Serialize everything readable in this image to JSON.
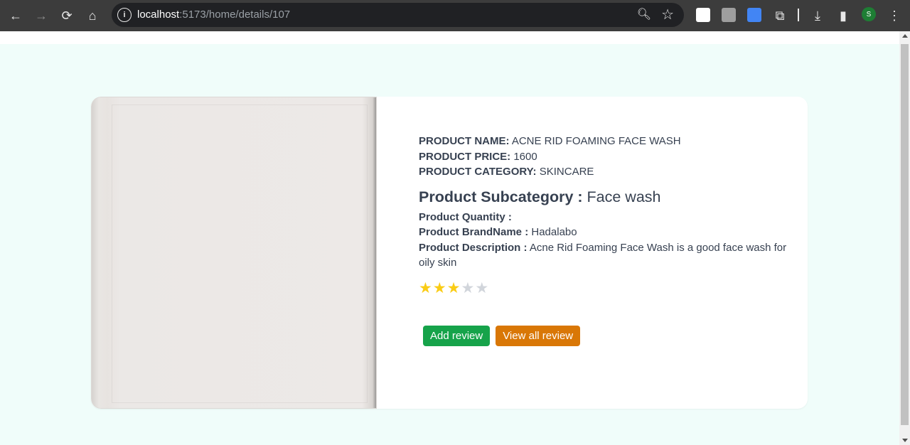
{
  "browser": {
    "url_host": "localhost",
    "url_path": ":5173/home/details/107",
    "profile_initial": "S",
    "icons": [
      "back-arrow-icon",
      "forward-arrow-icon",
      "reload-icon",
      "home-icon",
      "site-info-icon",
      "zoom-icon",
      "bookmark-star-icon",
      "extension-icon",
      "download-icon",
      "side-panel-icon",
      "menu-icon"
    ]
  },
  "product": {
    "name_label": "PRODUCT NAME:",
    "name_value": " ACNE RID FOAMING FACE WASH",
    "price_label": "PRODUCT PRICE:",
    "price_value": " 1600",
    "category_label": "PRODUCT CATEGORY:",
    "category_value": " SKINCARE",
    "subcategory_label": "Product Subcategory :",
    "subcategory_value": " Face wash",
    "quantity_label": "Product Quantity :",
    "quantity_value": "",
    "brand_label": "Product BrandName :",
    "brand_value": " Hadalabo",
    "description_label": "Product Description :",
    "description_value": " Acne Rid Foaming Face Wash is a good face wash for oily skin",
    "rating": 3,
    "rating_max": 5
  },
  "actions": {
    "add_review": "Add review",
    "view_all_review": "View all review"
  },
  "colors": {
    "page_bg": "#f0fdfa",
    "star_on": "#facc15",
    "star_off": "#d1d5db",
    "add_button": "#16a34a",
    "view_button": "#d97706"
  }
}
